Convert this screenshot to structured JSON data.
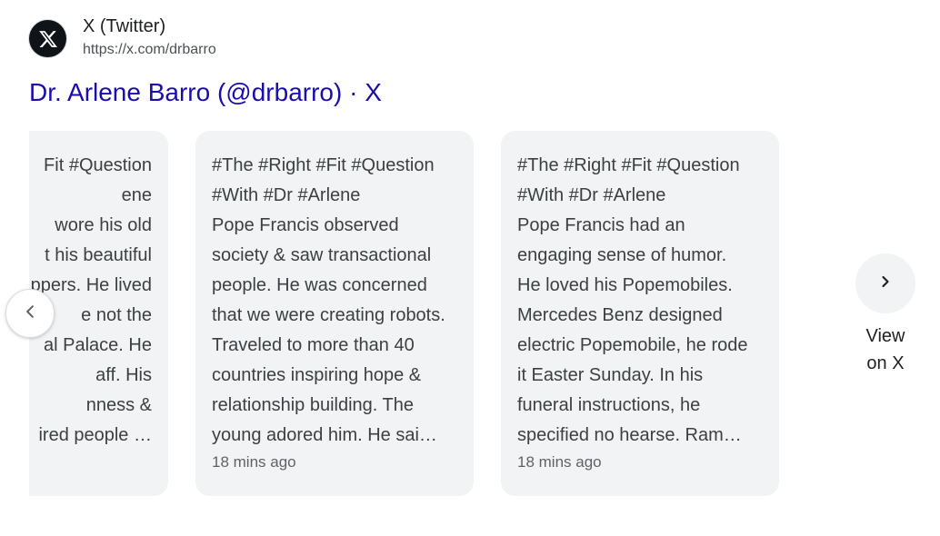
{
  "source": {
    "icon": "x-logo-icon",
    "name": "X (Twitter)",
    "url": "https://x.com/drbarro"
  },
  "result": {
    "title": "Dr. Arlene Barro (@drbarro) · X"
  },
  "colors": {
    "title_link": "#1a0dab",
    "card_background": "#f1f3f4",
    "card_text": "#3c4043",
    "muted_text": "#5f6368"
  },
  "cards": [
    {
      "lines": [
        "Fit #Question",
        "ene",
        "wore his old",
        "t his beautiful",
        "ppers. He lived",
        "e not the",
        "al Palace. He",
        "aff. His",
        "nness &",
        "ired people …"
      ],
      "time": ""
    },
    {
      "lines": [
        "#The #Right #Fit #Question",
        "#With #Dr #Arlene",
        "Pope Francis observed",
        "society & saw transactional",
        "people. He was concerned",
        "that we were creating robots.",
        "Traveled to more than 40",
        "countries inspiring hope &",
        "relationship building. The",
        "young adored him. He sai…"
      ],
      "time": "18 mins ago"
    },
    {
      "lines": [
        "#The #Right #Fit #Question",
        "#With #Dr #Arlene",
        "Pope Francis had an",
        "engaging sense of humor.",
        "He loved his Popemobiles.",
        "Mercedes Benz designed",
        "electric Popemobile, he rode",
        "it Easter Sunday. In his",
        "funeral instructions, he",
        "specified no hearse. Ram…"
      ],
      "time": "18 mins ago"
    }
  ],
  "navigation": {
    "prev_icon": "chevron-left-icon",
    "next_icon": "chevron-right-icon",
    "view_line1": "View",
    "view_line2": "on X"
  }
}
